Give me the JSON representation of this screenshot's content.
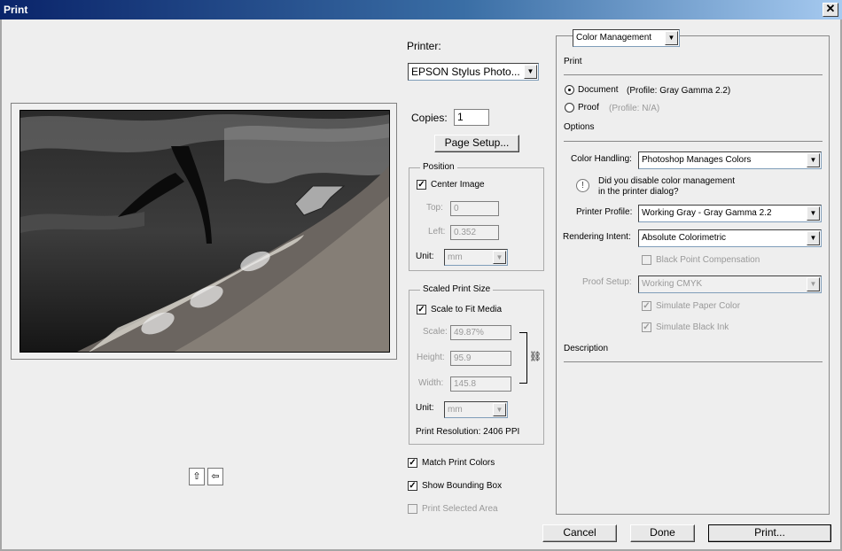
{
  "window": {
    "title": "Print",
    "close_glyph": "✕"
  },
  "printer": {
    "label": "Printer:",
    "selected": "EPSON Stylus Photo...",
    "copies_label": "Copies:",
    "copies_value": "1",
    "page_setup_button": "Page Setup..."
  },
  "position": {
    "title": "Position",
    "center_image_label": "Center Image",
    "center_image_checked": true,
    "top_label": "Top:",
    "top_value": "0",
    "left_label": "Left:",
    "left_value": "0.352",
    "unit_label": "Unit:",
    "unit_value": "mm"
  },
  "scaled": {
    "title": "Scaled Print Size",
    "scale_to_fit_label": "Scale to Fit Media",
    "scale_to_fit_checked": true,
    "scale_label": "Scale:",
    "scale_value": "49.87%",
    "height_label": "Height:",
    "height_value": "95.9",
    "width_label": "Width:",
    "width_value": "145.8",
    "unit_label": "Unit:",
    "unit_value": "mm",
    "resolution_text": "Print Resolution: 2406 PPI"
  },
  "options_bottom": {
    "match_print_colors": "Match Print Colors",
    "show_bounding_box": "Show Bounding Box",
    "print_selected_area": "Print Selected Area"
  },
  "color_mgmt": {
    "section_select": "Color Management",
    "print_header": "Print",
    "document_label": "Document",
    "document_profile": "(Profile: Gray Gamma 2.2)",
    "proof_label": "Proof",
    "proof_profile": "(Profile: N/A)",
    "options_header": "Options",
    "color_handling_label": "Color Handling:",
    "color_handling_value": "Photoshop Manages Colors",
    "notice_line1": "Did you disable color management",
    "notice_line2": "in the printer dialog?",
    "printer_profile_label": "Printer Profile:",
    "printer_profile_value": "Working Gray - Gray Gamma 2.2",
    "rendering_intent_label": "Rendering Intent:",
    "rendering_intent_value": "Absolute Colorimetric",
    "black_point_label": "Black Point Compensation",
    "proof_setup_label": "Proof Setup:",
    "proof_setup_value": "Working CMYK",
    "simulate_paper_label": "Simulate Paper Color",
    "simulate_black_label": "Simulate Black Ink",
    "description_header": "Description"
  },
  "buttons": {
    "cancel": "Cancel",
    "done": "Done",
    "print": "Print..."
  },
  "preview": {
    "thumb_left_glyph": "⇧",
    "thumb_right_glyph": "⇦"
  },
  "icons": {
    "dropdown": "▼",
    "check": "✓",
    "info": "!",
    "chain": "⛓"
  }
}
